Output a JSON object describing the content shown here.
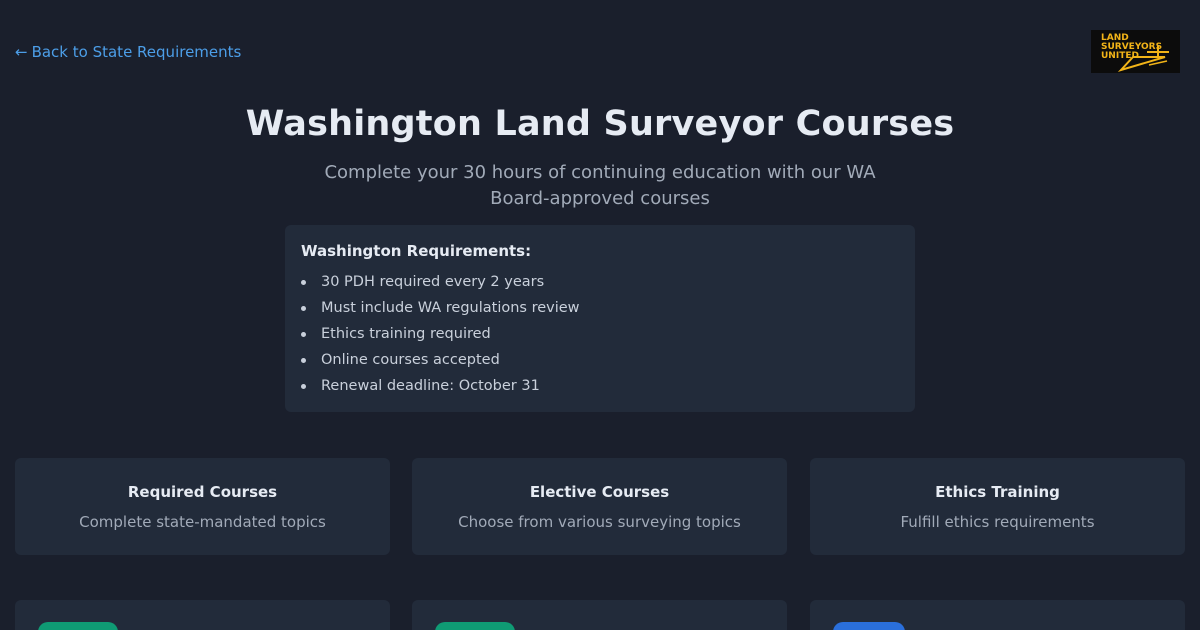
{
  "nav": {
    "back_arrow": "←",
    "back_label": "Back to State Requirements"
  },
  "logo": {
    "line1": "LAND",
    "line2": "SURVEYORS",
    "line3": "UNITED"
  },
  "hero": {
    "title": "Washington Land Surveyor Courses",
    "subtitle": "Complete your 30 hours of continuing education with our WA Board-approved courses"
  },
  "requirements": {
    "title": "Washington Requirements:",
    "items": [
      "30 PDH required every 2 years",
      "Must include WA regulations review",
      "Ethics training required",
      "Online courses accepted",
      "Renewal deadline: October 31"
    ]
  },
  "categories": [
    {
      "title": "Required Courses",
      "description": "Complete state-mandated topics"
    },
    {
      "title": "Elective Courses",
      "description": "Choose from various surveying topics"
    },
    {
      "title": "Ethics Training",
      "description": "Fulfill ethics requirements"
    }
  ],
  "course_cards": [
    {
      "badge_color": "#0f9b74"
    },
    {
      "badge_color": "#0f9b74"
    },
    {
      "badge_color": "#2a6fdb"
    }
  ],
  "colors": {
    "background": "#1a1f2c",
    "card": "#222b3a",
    "link": "#4c9ee8",
    "logo_text": "#f2b418"
  }
}
